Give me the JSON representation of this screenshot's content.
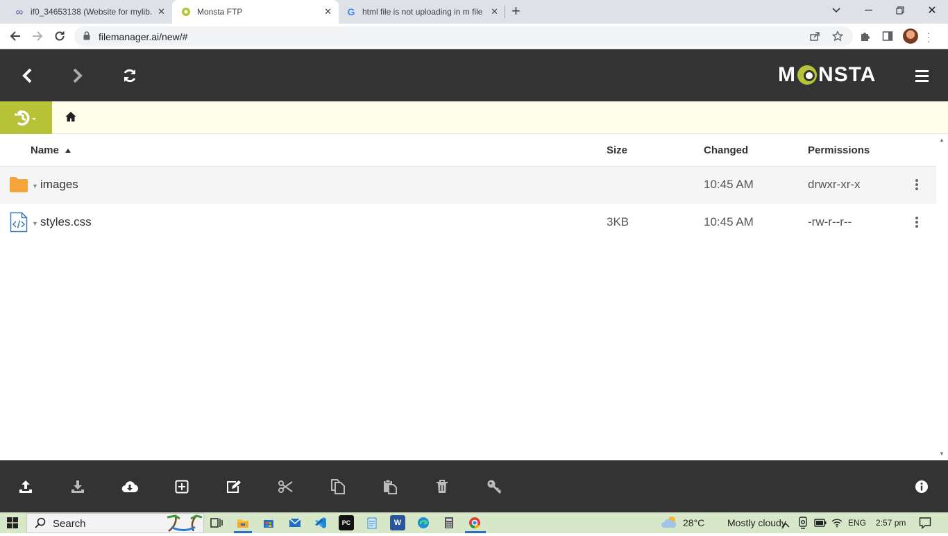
{
  "browser": {
    "tabs": [
      {
        "title": "if0_34653138 (Website for mylib.i",
        "icon": "infinity-icon",
        "active": false
      },
      {
        "title": "Monsta FTP",
        "icon": "monsta-icon",
        "active": true
      },
      {
        "title": "html file is not uploading in m file",
        "icon": "google-icon",
        "active": false
      }
    ],
    "url": "filemanager.ai/new/#"
  },
  "app": {
    "brand": {
      "before": "M",
      "after": "NSTA",
      "accent": "#b7c43a"
    },
    "columns": {
      "name": "Name",
      "size": "Size",
      "changed": "Changed",
      "permissions": "Permissions"
    },
    "files": [
      {
        "name": "images",
        "type": "folder",
        "size": "",
        "changed": "10:45 AM",
        "permissions": "drwxr-xr-x"
      },
      {
        "name": "styles.css",
        "type": "code-file",
        "size": "3KB",
        "changed": "10:45 AM",
        "permissions": "-rw-r--r--"
      }
    ],
    "footer_actions": [
      "upload",
      "download",
      "download-cloud",
      "new-item",
      "edit",
      "cut",
      "copy",
      "paste",
      "delete",
      "permissions",
      "info"
    ]
  },
  "taskbar": {
    "search_label": "Search",
    "weather": {
      "temp": "28°C",
      "text": "Mostly cloudy"
    },
    "language": "ENG",
    "time": "2:57 pm"
  }
}
